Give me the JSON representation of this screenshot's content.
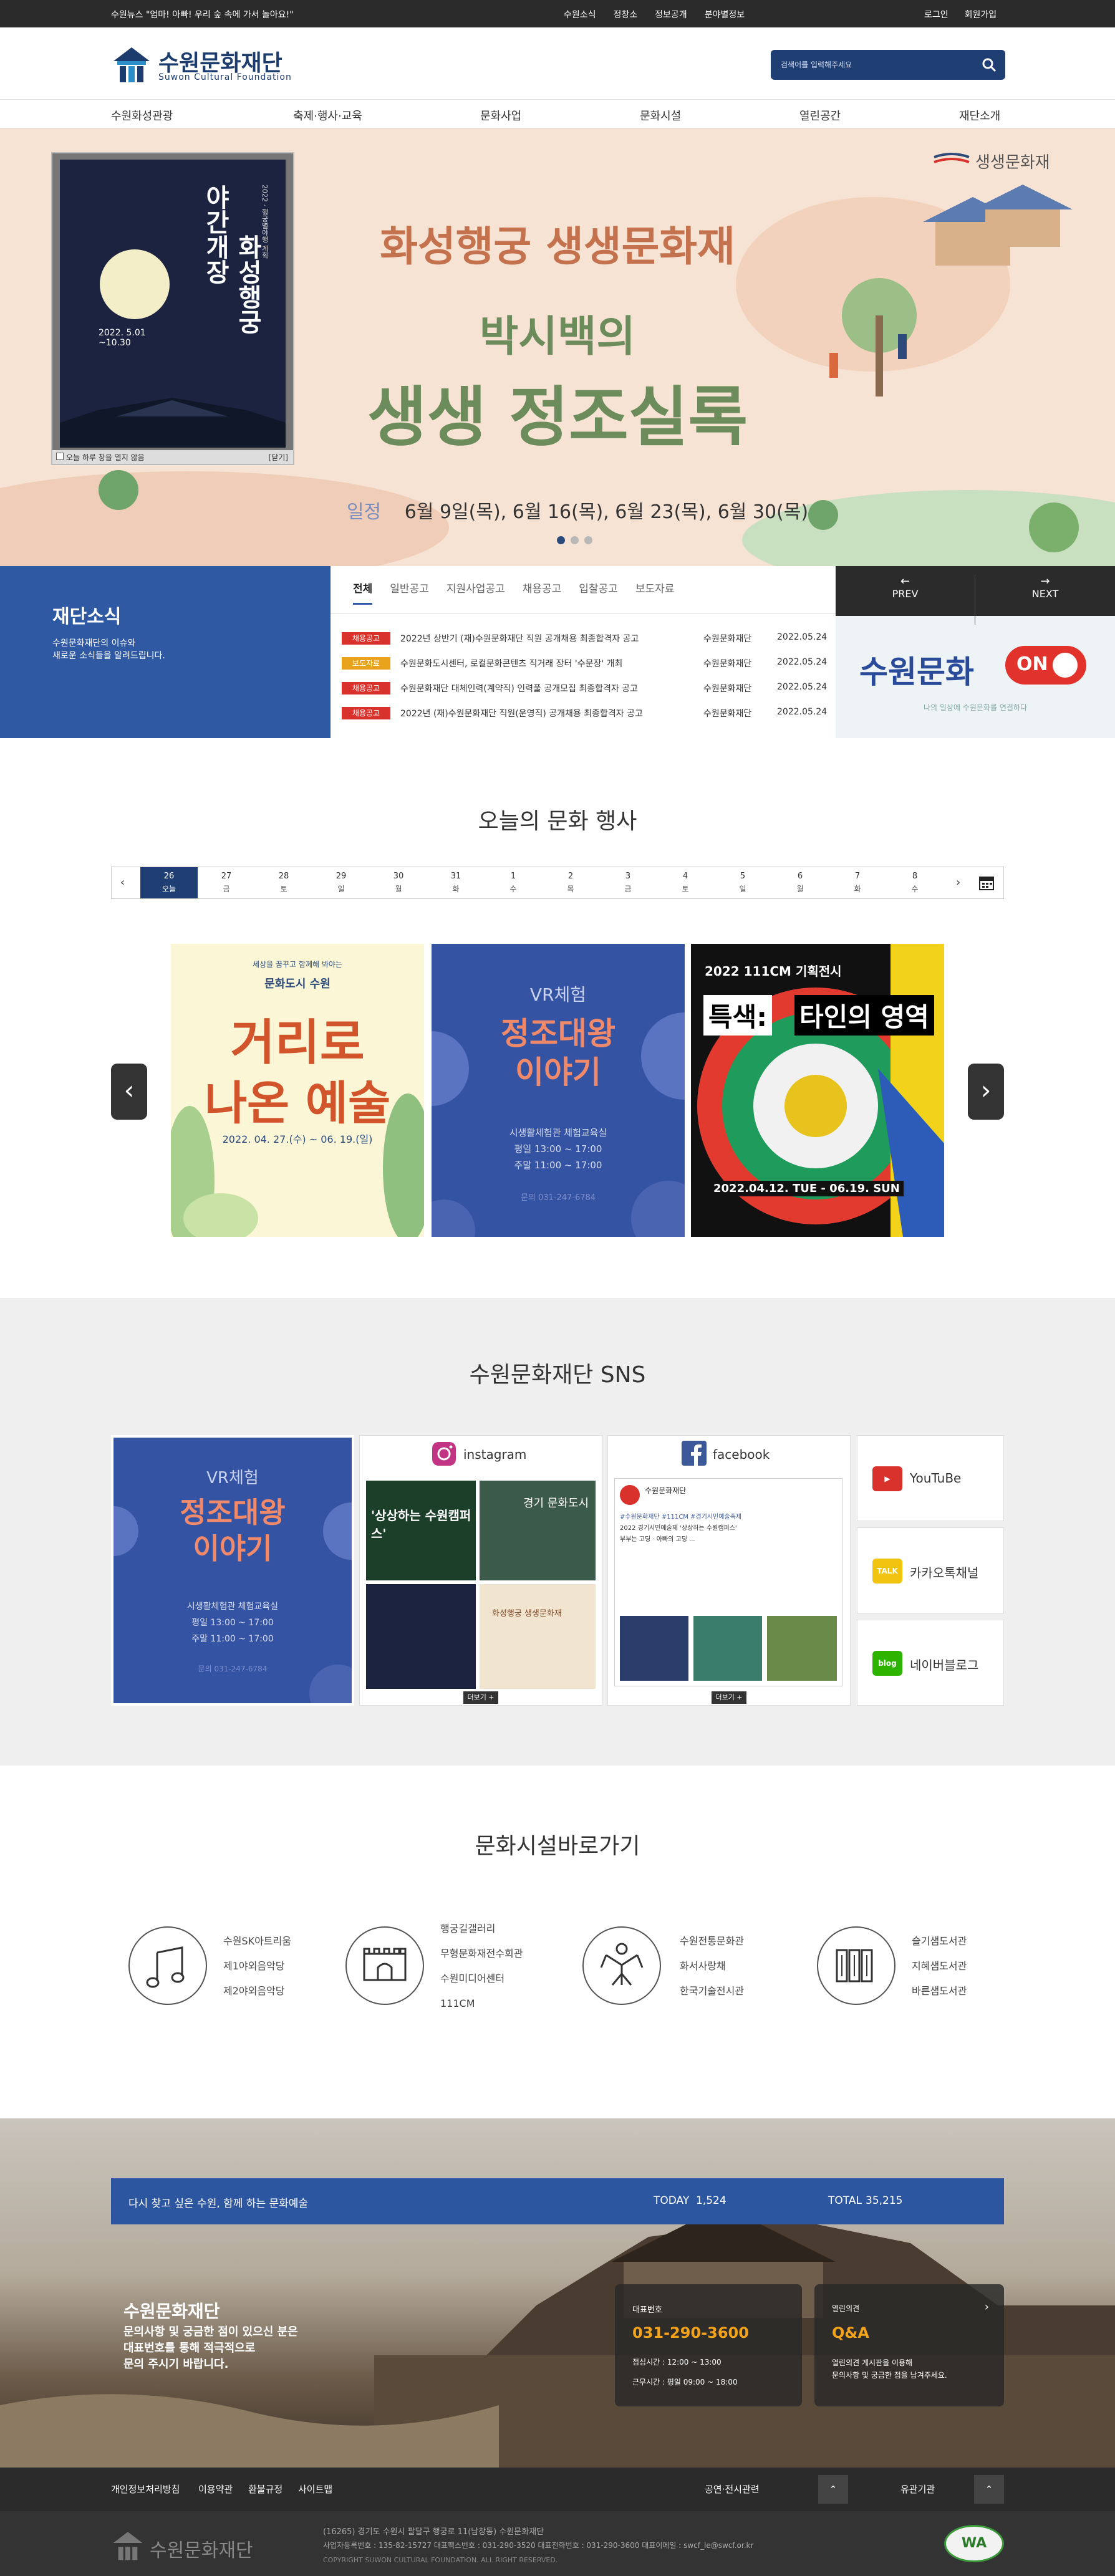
{
  "topbar": {
    "news": "수원뉴스 \"엄마! 아빠! 우리 숲 속에 가서 놀아요!\"",
    "mid_links": [
      "수원소식",
      "정창소",
      "정보공개",
      "분야별정보"
    ],
    "right_links": [
      "로그인",
      "회원가입"
    ]
  },
  "header": {
    "logo_ko": "수원문화재단",
    "logo_en": "Suwon Cultural Foundation",
    "search_placeholder": "검색어를 입력해주세요"
  },
  "gnb": [
    "수원화성관광",
    "축제·행사·교육",
    "문화사업",
    "문화시설",
    "열린공간",
    "재단소개"
  ],
  "hero": {
    "brand": "생생문화재",
    "title1": "화성행궁 생생문화재",
    "title2": "박시백의",
    "title3": "생생 정조실록",
    "schedule_label": "일정",
    "schedule": "6월 9일(목), 6월 16(목), 6월 23(목), 6월 30(목)",
    "popup": {
      "vertical1": "야간개장",
      "vertical2": "화성행궁",
      "year_small": "2022 · 행궁별야행 계획",
      "date": "2022. 5.01 ~10.30",
      "checkbox_label": "오늘 하루 창을 열지 않음",
      "close_label": "[닫기]"
    },
    "dots": 3
  },
  "news": {
    "title": "재단소식",
    "desc": "수원문화재단의 이슈와\n새로운 소식들을 알려드립니다.",
    "tabs": [
      "전체",
      "일반공고",
      "지원사업공고",
      "채용공고",
      "입찰공고",
      "보도자료"
    ],
    "rows": [
      {
        "badge": "채용공고",
        "badge_color": "#d9312b",
        "title": "2022년 상반기 (재)수원문화재단 직원 공개채용 최종합격자 공고",
        "org": "수원문화재단",
        "date": "2022.05.24"
      },
      {
        "badge": "보도자료",
        "badge_color": "#e8a21b",
        "title": "수원문화도시센터, 로컬문화콘텐츠 직거래 장터 '수문장' 개최",
        "org": "수원문화재단",
        "date": "2022.05.24"
      },
      {
        "badge": "채용공고",
        "badge_color": "#d9312b",
        "title": "수원문화재단 대체인력(계약직) 인력풀 공개모집 최종합격자 공고",
        "org": "수원문화재단",
        "date": "2022.05.24"
      },
      {
        "badge": "채용공고",
        "badge_color": "#d9312b",
        "title": "2022년 (재)수원문화재단 직원(운영직) 공개채용 최종합격자 공고",
        "org": "수원문화재단",
        "date": "2022.05.24"
      }
    ],
    "prev": "PREV",
    "next": "NEXT",
    "banner_text": "수원문화",
    "banner_on": "ON",
    "banner_sub": "나의 일상에 수원문화를 연결하다"
  },
  "events": {
    "title": "오늘의 문화 행사",
    "dates": [
      {
        "n": "26",
        "w": "오늘"
      },
      {
        "n": "27",
        "w": "금"
      },
      {
        "n": "28",
        "w": "토"
      },
      {
        "n": "29",
        "w": "일"
      },
      {
        "n": "30",
        "w": "월"
      },
      {
        "n": "31",
        "w": "화"
      },
      {
        "n": "1",
        "w": "수"
      },
      {
        "n": "2",
        "w": "목"
      },
      {
        "n": "3",
        "w": "금"
      },
      {
        "n": "4",
        "w": "토"
      },
      {
        "n": "5",
        "w": "일"
      },
      {
        "n": "6",
        "w": "월"
      },
      {
        "n": "7",
        "w": "화"
      },
      {
        "n": "8",
        "w": "수"
      }
    ],
    "cards": [
      {
        "top": "세상을 꿈꾸고 함께해 봐야는",
        "sub": "문화도시 수원",
        "title1": "거리로",
        "title2": "나온 예술",
        "date": "2022. 04. 27.(수) ~ 06. 19.(일)"
      },
      {
        "top": "VR체험",
        "title1": "정조대왕",
        "title2": "이야기",
        "info1": "시생활체험관 체험교육실",
        "info2": "평일 13:00 ~ 17:00",
        "info3": "주말 11:00 ~ 17:00",
        "tel": "문의 031-247-6784"
      },
      {
        "top": "2022 111CM 기획전시",
        "title1": "특색:",
        "title2": "타인의 영역",
        "date": "2022.04.12. TUE - 06.19. SUN"
      }
    ]
  },
  "sns": {
    "title": "수원문화재단 SNS",
    "instagram": "instagram",
    "facebook": "facebook",
    "more": "더보기 +",
    "fb_post_name": "수원문화재단",
    "fb_post_lines": [
      "#수원문화재단 #111CM #경기시민예술축제",
      "2022 경기시민예술제 '상상하는 수원캠퍼스'",
      "부부는 고딩 · 아빠의 고딩 ..."
    ],
    "buttons": [
      {
        "label": "YouTuBe",
        "icon": "youtube-icon",
        "color": "#d9312b",
        "icon_text": "▶"
      },
      {
        "label": "카카오톡채널",
        "icon": "kakaotalk-icon",
        "color": "#f1c40f",
        "icon_text": "TALK"
      },
      {
        "label": "네이버블로그",
        "icon": "naver-blog-icon",
        "color": "#2db400",
        "icon_text": "blog"
      }
    ],
    "vr_card": {
      "top": "VR체험",
      "title1": "정조대왕",
      "title2": "이야기",
      "info1": "시생활체험관 체험교육실",
      "info2": "평일 13:00 ~ 17:00",
      "info3": "주말 11:00 ~ 17:00",
      "tel": "문의 031-247-6784"
    },
    "insta_tiles": [
      "'상상하는 수원캠퍼스'",
      "경기 문화도시",
      "",
      "화성행궁 생생문화재"
    ]
  },
  "facilities": {
    "title": "문화시설바로가기",
    "groups": [
      {
        "icon": "music-note-icon",
        "items": [
          "수원SK아트리움",
          "제1야외음악당",
          "제2야외음악당"
        ]
      },
      {
        "icon": "fortress-gate-icon",
        "items": [
          "행궁길갤러리",
          "무형문화재전수회관",
          "수원미디어센터",
          "111CM"
        ]
      },
      {
        "icon": "dance-mask-icon",
        "items": [
          "수원전통문화관",
          "화서사랑채",
          "한국기술전시관"
        ]
      },
      {
        "icon": "books-icon",
        "items": [
          "슬기샘도서관",
          "지혜샘도서관",
          "바른샘도서관"
        ]
      }
    ]
  },
  "visit": {
    "slogan": "다시 찾고 싶은 수원, 함께 하는 문화예술",
    "today_label": "TODAY",
    "today": "1,524",
    "total_label": "TOTAL",
    "total": "35,215"
  },
  "contact": {
    "title": "수원문화재단",
    "desc": "문의사항 및 궁금한 점이 있으신 분은\n대표번호를 통해 적극적으로\n문의 주시기 바랍니다.",
    "phone_label": "대표번호",
    "phone": "031-290-3600",
    "lunch": "점심시간 : 12:00 ~ 13:00",
    "hours": "근무시간 : 평일 09:00 ~ 18:00",
    "qa_label": "열린의견",
    "qa_title": "Q&A",
    "qa_desc": "열린의견 게시판을 이용해\n문의사항 및 궁금한 점을 남겨주세요."
  },
  "footer": {
    "links": [
      "개인정보처리방침",
      "이용약관",
      "환불규정",
      "사이트맵"
    ],
    "related1": "공연·전시관련",
    "related2": "유관기관",
    "logo": "수원문화재단",
    "address": "(16265) 경기도 수원시 팔달구 행궁로 11(남창동) 수원문화재단",
    "line2": "사업자등록번호 : 135-82-15727    대표팩스번호 : 031-290-3520    대표전화번호 : 031-290-3600    대표이메일 : swcf_le@swcf.or.kr",
    "copy": "COPYRIGHT SUWON CULTURAL FOUNDATION. ALL RIGHT RESERVED.",
    "wa_mark": "WA"
  }
}
